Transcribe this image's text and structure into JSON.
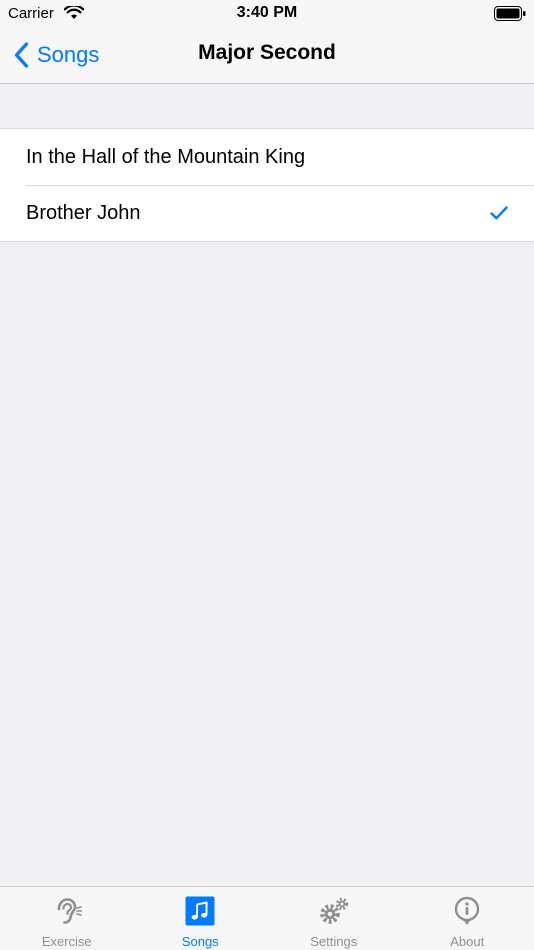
{
  "status_bar": {
    "carrier": "Carrier",
    "time": "3:40 PM"
  },
  "nav": {
    "back_label": "Songs",
    "title": "Major Second"
  },
  "songs": [
    {
      "title": "In the Hall of the Mountain King",
      "selected": false
    },
    {
      "title": "Brother John",
      "selected": true
    }
  ],
  "tabs": [
    {
      "label": "Exercise",
      "icon": "ear-icon",
      "active": false
    },
    {
      "label": "Songs",
      "icon": "music-note-icon",
      "active": true
    },
    {
      "label": "Settings",
      "icon": "gears-icon",
      "active": false
    },
    {
      "label": "About",
      "icon": "info-icon",
      "active": false
    }
  ],
  "colors": {
    "accent": "#007aff",
    "inactive": "#8e8e93",
    "background": "#efeff4"
  }
}
